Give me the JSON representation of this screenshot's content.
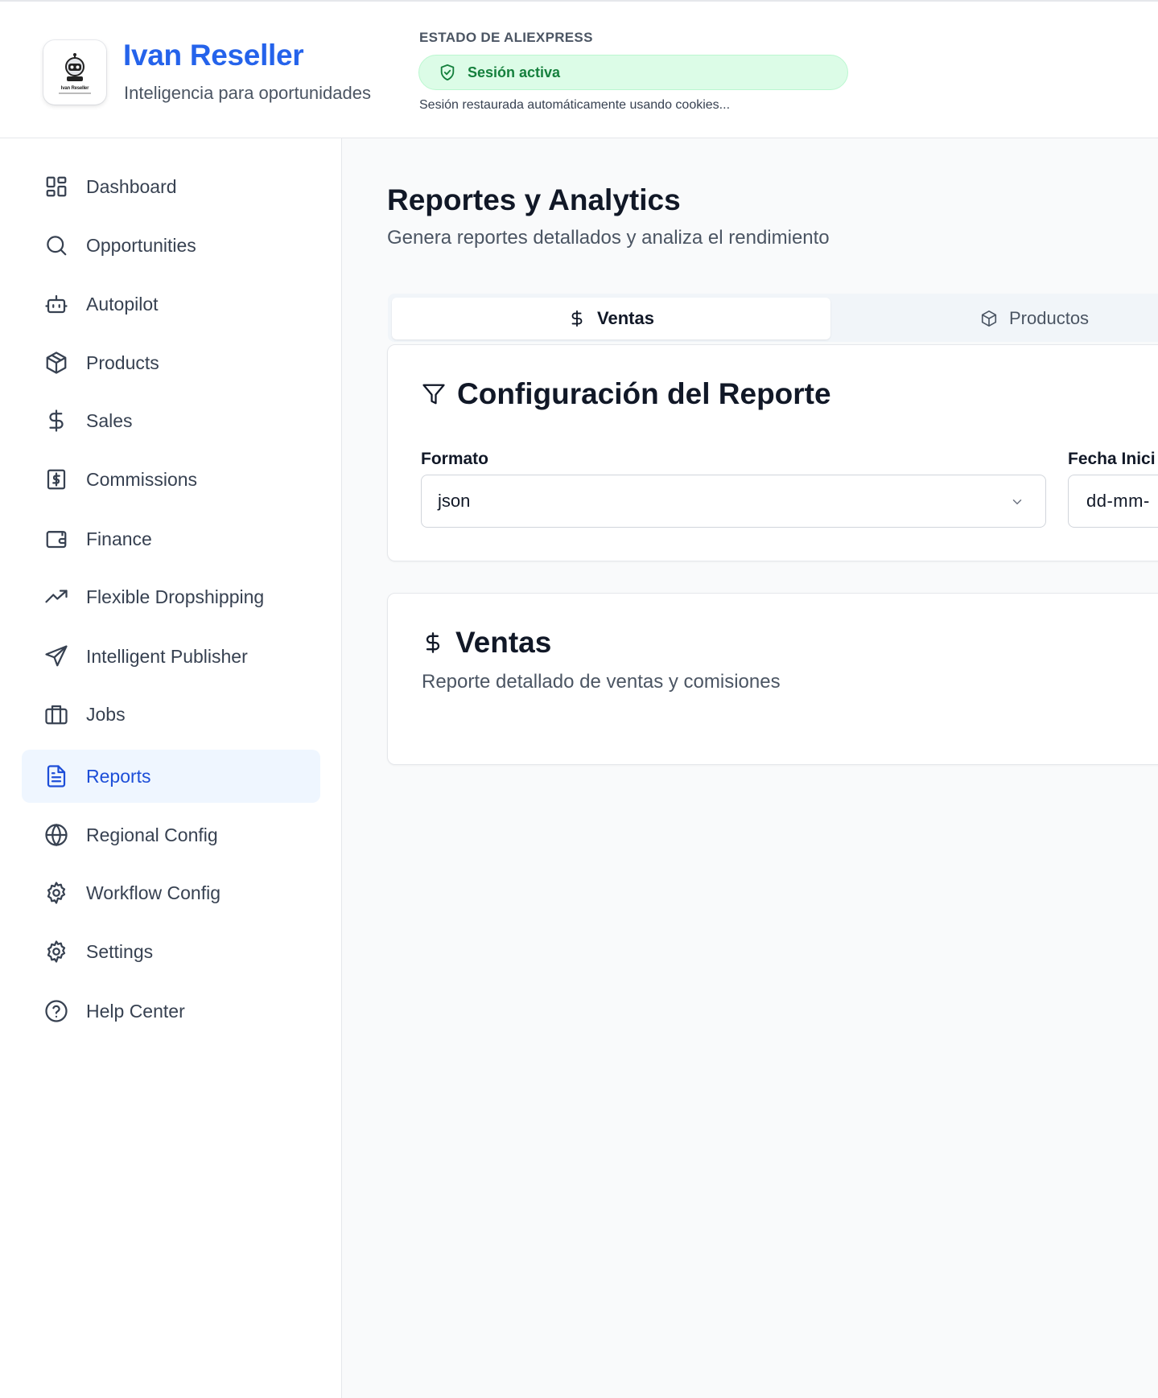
{
  "header": {
    "logo_text": "Ivan Reseller",
    "brand_name": "Ivan Reseller",
    "brand_tagline": "Inteligencia para oportunidades",
    "aliexpress_label": "ESTADO DE ALIEXPRESS",
    "session_status": "Sesión activa",
    "session_note": "Sesión restaurada automáticamente usando cookies...",
    "status_color": "#15803d"
  },
  "sidebar": {
    "items": [
      {
        "label": "Dashboard",
        "icon": "dashboard-grid-icon"
      },
      {
        "label": "Opportunities",
        "icon": "search-icon"
      },
      {
        "label": "Autopilot",
        "icon": "bot-icon"
      },
      {
        "label": "Products",
        "icon": "package-icon"
      },
      {
        "label": "Sales",
        "icon": "dollar-icon"
      },
      {
        "label": "Commissions",
        "icon": "receipt-dollar-icon"
      },
      {
        "label": "Finance",
        "icon": "wallet-icon"
      },
      {
        "label": "Flexible Dropshipping",
        "icon": "trending-up-icon"
      },
      {
        "label": "Intelligent Publisher",
        "icon": "send-icon"
      },
      {
        "label": "Jobs",
        "icon": "briefcase-icon"
      },
      {
        "label": "Reports",
        "icon": "file-text-icon",
        "active": true
      },
      {
        "label": "Regional Config",
        "icon": "globe-icon"
      },
      {
        "label": "Workflow Config",
        "icon": "gear-icon"
      },
      {
        "label": "Settings",
        "icon": "gear-icon"
      },
      {
        "label": "Help Center",
        "icon": "help-circle-icon"
      }
    ],
    "accent_color": "#1d4ed8"
  },
  "main": {
    "title": "Reportes y Analytics",
    "subtitle": "Genera reportes detallados y analiza el rendimiento",
    "tabs": [
      {
        "label": "Ventas",
        "icon": "dollar-icon",
        "active": true
      },
      {
        "label": "Productos",
        "icon": "package-icon"
      }
    ],
    "config": {
      "title": "Configuración del Reporte",
      "format_label": "Formato",
      "format_value": "json",
      "start_date_label": "Fecha Inici",
      "start_date_value": "dd-mm-"
    },
    "sales_section": {
      "title": "Ventas",
      "subtitle": "Reporte detallado de ventas y comisiones"
    }
  }
}
